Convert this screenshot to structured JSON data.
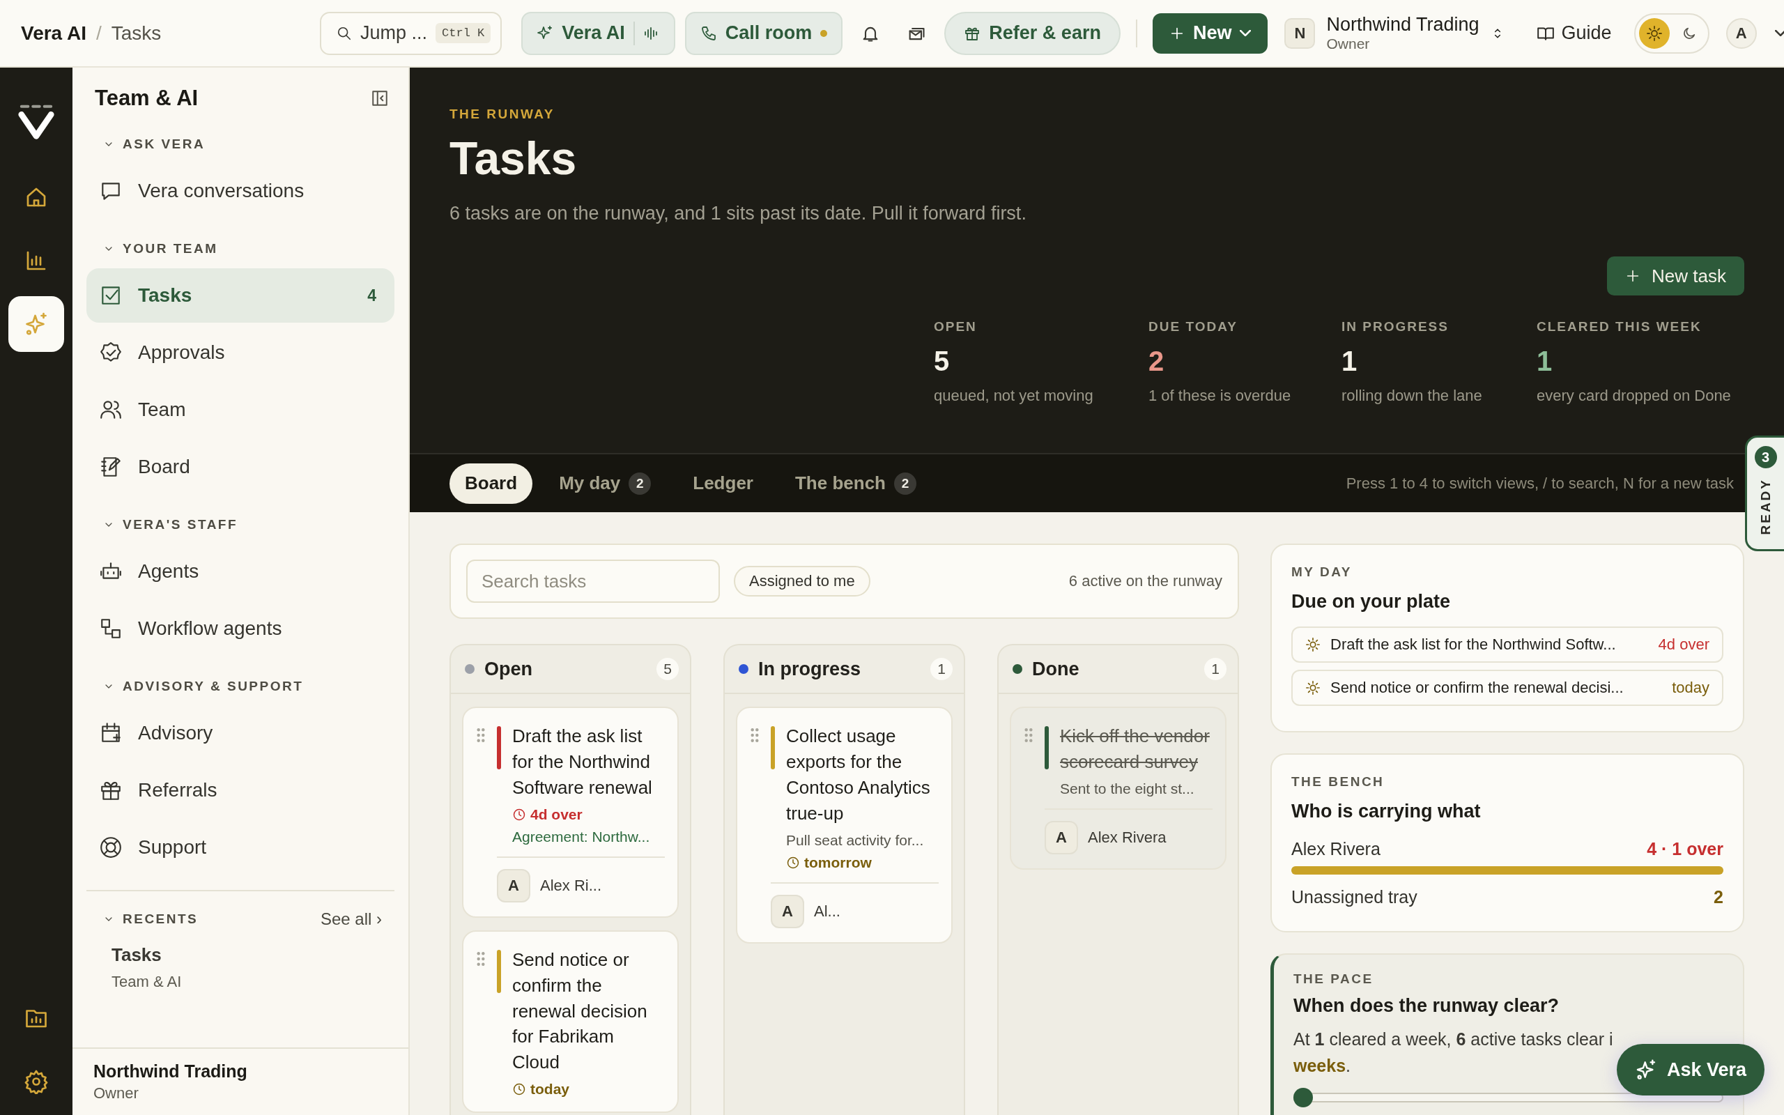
{
  "topbar": {
    "breadcrumb": [
      "Vera AI",
      "/",
      "Tasks"
    ],
    "jump": {
      "label": "Jump ...",
      "shortcut": "Ctrl K"
    },
    "vera_button": "Vera AI",
    "call_button": "Call room",
    "refer_button": "Refer & earn",
    "new_button": "New",
    "org": {
      "initial": "N",
      "name": "Northwind Trading",
      "role": "Owner"
    },
    "guide_button": "Guide",
    "theme_options": [
      {
        "kind": "light",
        "selected": true
      },
      {
        "kind": "dark",
        "selected": false
      }
    ],
    "user_initial": "A"
  },
  "sidebar": {
    "title": "Team & AI",
    "sections": [
      {
        "label": "ASK VERA",
        "expanded": true,
        "items": [
          {
            "label": "Vera conversations",
            "selected": false
          }
        ]
      },
      {
        "label": "YOUR TEAM",
        "expanded": true,
        "items": [
          {
            "label": "Tasks",
            "selected": true,
            "count": "4"
          },
          {
            "label": "Approvals",
            "selected": false
          },
          {
            "label": "Team",
            "selected": false
          },
          {
            "label": "Board",
            "selected": false
          }
        ]
      },
      {
        "label": "VERA'S STAFF",
        "expanded": true,
        "items": [
          {
            "label": "Agents",
            "selected": false
          },
          {
            "label": "Workflow agents",
            "selected": false
          }
        ]
      },
      {
        "label": "ADVISORY & SUPPORT",
        "expanded": true,
        "items": [
          {
            "label": "Advisory",
            "selected": false
          },
          {
            "label": "Referrals",
            "selected": false
          },
          {
            "label": "Support",
            "selected": false
          }
        ]
      }
    ],
    "recents": {
      "label": "RECENTS",
      "expanded": true,
      "link": "See all ›",
      "items": [
        {
          "title": "Tasks",
          "subtitle": "Team & AI"
        }
      ]
    },
    "footer": {
      "name": "Northwind Trading",
      "role": "Owner"
    }
  },
  "header": {
    "eyebrow": "THE RUNWAY",
    "title": "Tasks",
    "subtitle": "6 tasks are on the runway, and 1 sits past its date. Pull it forward first.",
    "new_task_button": "New task",
    "stats": [
      {
        "label": "OPEN",
        "value": "5",
        "caption": "queued, not yet moving",
        "color": "#f5f2e8"
      },
      {
        "label": "DUE TODAY",
        "value": "2",
        "caption": "1 of these is overdue",
        "color": "#e9978a"
      },
      {
        "label": "IN PROGRESS",
        "value": "1",
        "caption": "rolling down the lane",
        "color": "#f5f2e8"
      },
      {
        "label": "CLEARED THIS WEEK",
        "value": "1",
        "caption": "every card dropped on Done",
        "color": "#8dbd98"
      }
    ]
  },
  "ready_tab": {
    "count": "3",
    "label": "READY"
  },
  "tabs": [
    {
      "label": "Board",
      "selected": true
    },
    {
      "label": "My day",
      "selected": false,
      "count": "2"
    },
    {
      "label": "Ledger",
      "selected": false
    },
    {
      "label": "The bench",
      "selected": false,
      "count": "2"
    }
  ],
  "tab_hint": "Press 1 to 4 to switch views, / to search, N for a new task",
  "toolbar": {
    "search": {
      "placeholder": "Search tasks"
    },
    "filter_chip": "Assigned to me",
    "summary": "6 active on the runway"
  },
  "columns": [
    {
      "name": "Open",
      "color": "#9ca0a8",
      "count": "5",
      "cards": [
        {
          "title": "Draft the ask list for the Northwind Software renewal",
          "done": false,
          "color": "#c62f2f",
          "meta": [
            {
              "kind": "overdue",
              "text": "4d over"
            },
            {
              "kind": "link",
              "text": "Agreement: Northw..."
            }
          ],
          "assignee": {
            "initial": "A",
            "name": "Alex Ri..."
          }
        },
        {
          "title": "Send notice or confirm the renewal decision for Fabrikam Cloud",
          "done": false,
          "color": "#c9a227",
          "meta": [
            {
              "kind": "due",
              "text": "today"
            }
          ]
        }
      ]
    },
    {
      "name": "In progress",
      "color": "#2f55d4",
      "count": "1",
      "cards": [
        {
          "title": "Collect usage exports for the Contoso Analytics true-up",
          "done": false,
          "color": "#c9a227",
          "meta": [
            {
              "kind": "note",
              "text": "Pull seat activity for..."
            },
            {
              "kind": "due",
              "text": "tomorrow"
            }
          ],
          "assignee": {
            "initial": "A",
            "name": "Al..."
          }
        }
      ]
    },
    {
      "name": "Done",
      "color": "#2d5a3a",
      "count": "1",
      "cards": [
        {
          "title": "Kick off the vendor scorecard survey",
          "done": true,
          "color": "#2d5a3a",
          "meta": [
            {
              "kind": "note",
              "text": "Sent to the eight st..."
            }
          ],
          "assignee": {
            "initial": "A",
            "name": "Alex Rivera"
          }
        }
      ]
    }
  ],
  "my_day": {
    "eyebrow": "MY DAY",
    "title": "Due on your plate",
    "items": [
      {
        "text": "Draft the ask list for the Northwind Softw...",
        "due": "4d over",
        "color": "#c62f2f"
      },
      {
        "text": "Send notice or confirm the renewal decisi...",
        "due": "today",
        "color": "#7a5e0c"
      }
    ]
  },
  "bench": {
    "eyebrow": "THE BENCH",
    "title": "Who is carrying what",
    "rows": [
      {
        "name": "Alex Rivera",
        "value": "4 · 1 over",
        "color": "#c62f2f",
        "level": 1.0
      },
      {
        "name": "Unassigned tray",
        "value": "2",
        "color": "#7a5e0c"
      }
    ]
  },
  "pace": {
    "eyebrow": "THE PACE",
    "title": "When does the runway clear?",
    "text": "At **1** cleared a week, **6** active tasks clear i",
    "text_end": "weeks",
    "text_tail": ".",
    "level": 0.0
  },
  "ask_button": "Ask Vera"
}
